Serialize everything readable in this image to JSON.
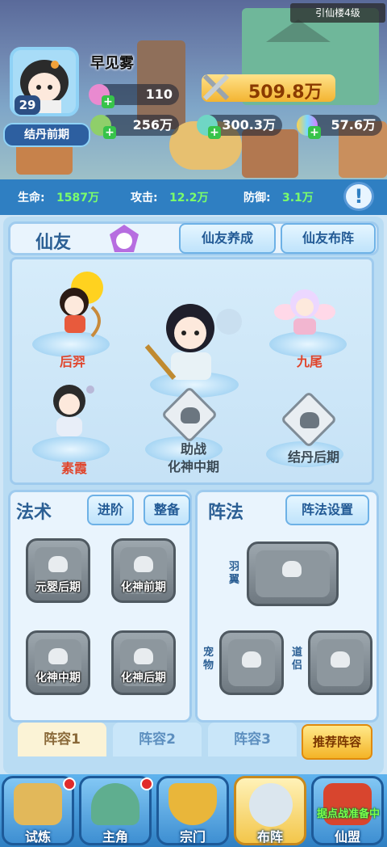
{
  "header": {
    "tower_label": "引仙楼4级",
    "player_name": "早见雾",
    "level": "29",
    "realm": "结丹前期",
    "stat_1": "110",
    "power": "509.8万",
    "resources": [
      {
        "name": "spirit-stone",
        "value": "256万"
      },
      {
        "name": "green-gem",
        "value": "300.3万"
      },
      {
        "name": "rainbow-gem",
        "value": "57.6万"
      }
    ]
  },
  "stats": {
    "hp_label": "生命:",
    "hp_value": "1587万",
    "atk_label": "攻击:",
    "atk_value": "12.2万",
    "def_label": "防御:",
    "def_value": "3.1万"
  },
  "fairy": {
    "title": "仙友",
    "btn_cultivate": "仙友养成",
    "btn_formation": "仙友布阵",
    "companions": [
      {
        "name": "后羿",
        "color": "#e0452c"
      },
      {
        "name": "九尾",
        "color": "#e0452c"
      },
      {
        "name": "素霞",
        "color": "#e0452c"
      }
    ],
    "assist_label": "助战",
    "assist_req": "化神中期",
    "locked_req": "结丹后期"
  },
  "spells": {
    "title": "法术",
    "btn_advance": "进阶",
    "btn_equip": "整备",
    "slots": [
      "元婴后期",
      "化神前期",
      "化神中期",
      "化神后期"
    ]
  },
  "array": {
    "title": "阵法",
    "btn_settings": "阵法设置",
    "wing_label": "羽翼",
    "pet_label": "宠物",
    "partner_label": "道侣"
  },
  "lineups": {
    "tabs": [
      "阵容1",
      "阵容2",
      "阵容3"
    ],
    "recommend": "推荐阵容"
  },
  "nav": {
    "items": [
      "试炼",
      "主角",
      "宗门",
      "布阵",
      "仙盟"
    ],
    "banner": "据点战准备中"
  },
  "colors": {
    "accent": "#2f7fc2",
    "stat_value": "#7cff6a",
    "companion_name": "#e0452c",
    "gold": "#f3b431"
  }
}
